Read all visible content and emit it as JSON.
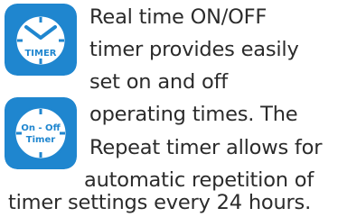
{
  "icons": {
    "timer": {
      "label": "TIMER",
      "color": "#1f86cf"
    },
    "on_off_timer": {
      "label_top": "On - Off",
      "label_bottom": "Timer",
      "color": "#1f86cf"
    }
  },
  "text": {
    "lines": [
      "Real time ON/OFF",
      "timer provides easily",
      "set on and off",
      "operating times. The",
      "Repeat timer allows for",
      "automatic repetition of",
      "timer settings every 24 hours."
    ]
  }
}
